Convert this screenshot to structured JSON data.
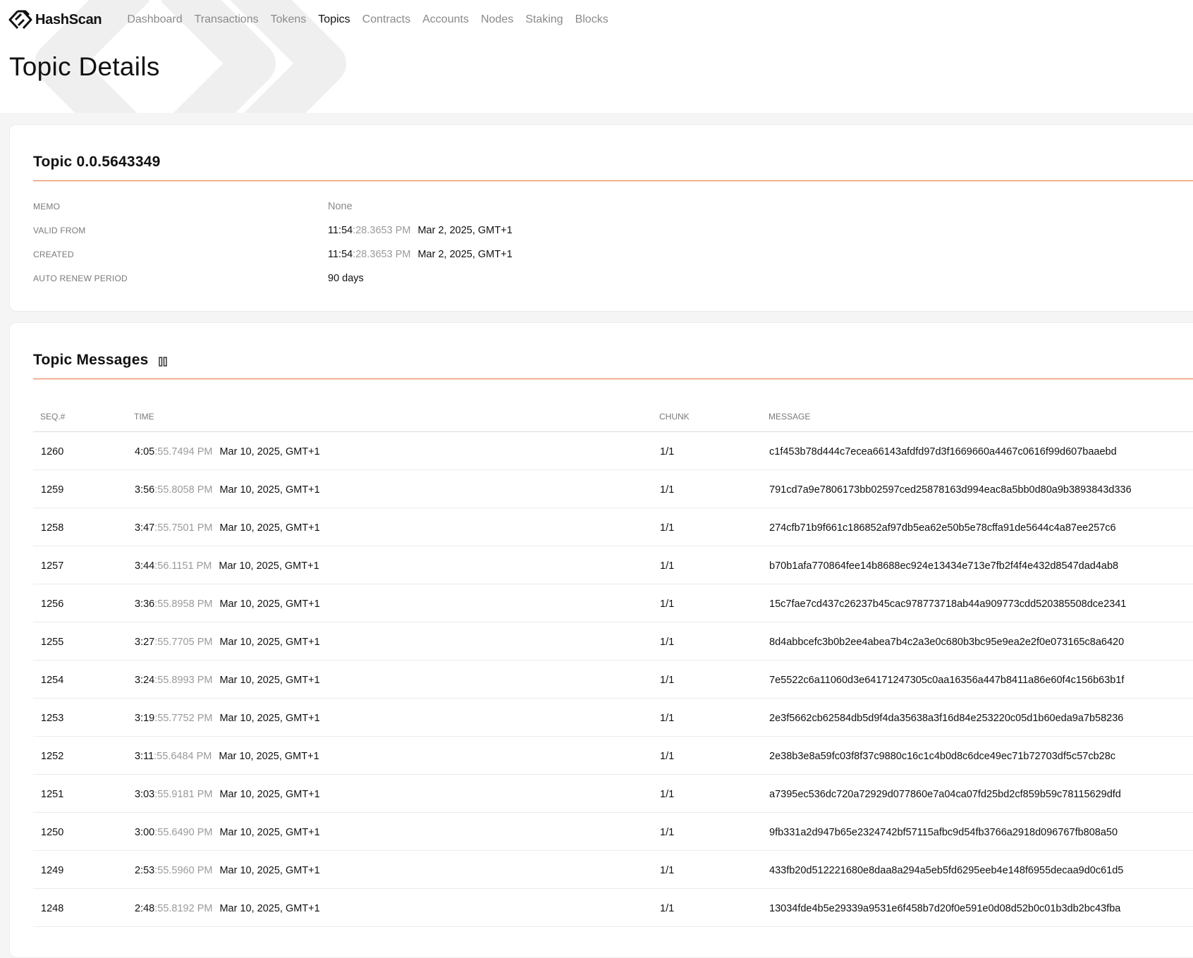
{
  "app": {
    "brand": "HashScan"
  },
  "nav": [
    {
      "label": "Dashboard",
      "active": false
    },
    {
      "label": "Transactions",
      "active": false
    },
    {
      "label": "Tokens",
      "active": false
    },
    {
      "label": "Topics",
      "active": true
    },
    {
      "label": "Contracts",
      "active": false
    },
    {
      "label": "Accounts",
      "active": false
    },
    {
      "label": "Nodes",
      "active": false
    },
    {
      "label": "Staking",
      "active": false
    },
    {
      "label": "Blocks",
      "active": false
    }
  ],
  "page": {
    "title": "Topic Details"
  },
  "topic": {
    "title": "Topic 0.0.5643349",
    "props": {
      "memo": {
        "label": "MEMO",
        "value": "None"
      },
      "valid_from": {
        "label": "VALID FROM",
        "hm": "11:54",
        "sec": ":28.3653 PM",
        "date": "Mar 2, 2025, GMT+1"
      },
      "created": {
        "label": "CREATED",
        "hm": "11:54",
        "sec": ":28.3653 PM",
        "date": "Mar 2, 2025, GMT+1"
      },
      "auto_renew": {
        "label": "AUTO RENEW PERIOD",
        "value": "90 days"
      }
    }
  },
  "messages": {
    "title": "Topic Messages",
    "columns": {
      "seq": "SEQ.#",
      "time": "TIME",
      "chunk": "CHUNK",
      "message": "MESSAGE"
    },
    "rows": [
      {
        "seq": "1260",
        "hm": "4:05",
        "sec": ":55.7494 PM",
        "date": "Mar 10, 2025, GMT+1",
        "chunk": "1/1",
        "message": "c1f453b78d444c7ecea66143afdfd97d3f1669660a4467c0616f99d607baaebd"
      },
      {
        "seq": "1259",
        "hm": "3:56",
        "sec": ":55.8058 PM",
        "date": "Mar 10, 2025, GMT+1",
        "chunk": "1/1",
        "message": "791cd7a9e7806173bb02597ced25878163d994eac8a5bb0d80a9b3893843d336"
      },
      {
        "seq": "1258",
        "hm": "3:47",
        "sec": ":55.7501 PM",
        "date": "Mar 10, 2025, GMT+1",
        "chunk": "1/1",
        "message": "274cfb71b9f661c186852af97db5ea62e50b5e78cffa91de5644c4a87ee257c6"
      },
      {
        "seq": "1257",
        "hm": "3:44",
        "sec": ":56.1151 PM",
        "date": "Mar 10, 2025, GMT+1",
        "chunk": "1/1",
        "message": "b70b1afa770864fee14b8688ec924e13434e713e7fb2f4f4e432d8547dad4ab8"
      },
      {
        "seq": "1256",
        "hm": "3:36",
        "sec": ":55.8958 PM",
        "date": "Mar 10, 2025, GMT+1",
        "chunk": "1/1",
        "message": "15c7fae7cd437c26237b45cac978773718ab44a909773cdd520385508dce2341"
      },
      {
        "seq": "1255",
        "hm": "3:27",
        "sec": ":55.7705 PM",
        "date": "Mar 10, 2025, GMT+1",
        "chunk": "1/1",
        "message": "8d4abbcefc3b0b2ee4abea7b4c2a3e0c680b3bc95e9ea2e2f0e073165c8a6420"
      },
      {
        "seq": "1254",
        "hm": "3:24",
        "sec": ":55.8993 PM",
        "date": "Mar 10, 2025, GMT+1",
        "chunk": "1/1",
        "message": "7e5522c6a11060d3e64171247305c0aa16356a447b8411a86e60f4c156b63b1f"
      },
      {
        "seq": "1253",
        "hm": "3:19",
        "sec": ":55.7752 PM",
        "date": "Mar 10, 2025, GMT+1",
        "chunk": "1/1",
        "message": "2e3f5662cb62584db5d9f4da35638a3f16d84e253220c05d1b60eda9a7b58236"
      },
      {
        "seq": "1252",
        "hm": "3:11",
        "sec": ":55.6484 PM",
        "date": "Mar 10, 2025, GMT+1",
        "chunk": "1/1",
        "message": "2e38b3e8a59fc03f8f37c9880c16c1c4b0d8c6dce49ec71b72703df5c57cb28c"
      },
      {
        "seq": "1251",
        "hm": "3:03",
        "sec": ":55.9181 PM",
        "date": "Mar 10, 2025, GMT+1",
        "chunk": "1/1",
        "message": "a7395ec536dc720a72929d077860e7a04ca07fd25bd2cf859b59c78115629dfd"
      },
      {
        "seq": "1250",
        "hm": "3:00",
        "sec": ":55.6490 PM",
        "date": "Mar 10, 2025, GMT+1",
        "chunk": "1/1",
        "message": "9fb331a2d947b65e2324742bf57115afbc9d54fb3766a2918d096767fb808a50"
      },
      {
        "seq": "1249",
        "hm": "2:53",
        "sec": ":55.5960 PM",
        "date": "Mar 10, 2025, GMT+1",
        "chunk": "1/1",
        "message": "433fb20d512221680e8daa8a294a5eb5fd6295eeb4e148f6955decaa9d0c61d5"
      },
      {
        "seq": "1248",
        "hm": "2:48",
        "sec": ":55.8192 PM",
        "date": "Mar 10, 2025, GMT+1",
        "chunk": "1/1",
        "message": "13034fde4b5e29339a9531e6f458b7d20f0e591e0d08d52b0c01b3db2bc43fba"
      }
    ]
  },
  "colors": {
    "accent": "#e8703a",
    "muted": "#8a8a8a",
    "text": "#111111",
    "background": "#f5f5f5"
  },
  "icons": {
    "brand": "hashscan-logo-icon",
    "pause": "pause-icon"
  }
}
